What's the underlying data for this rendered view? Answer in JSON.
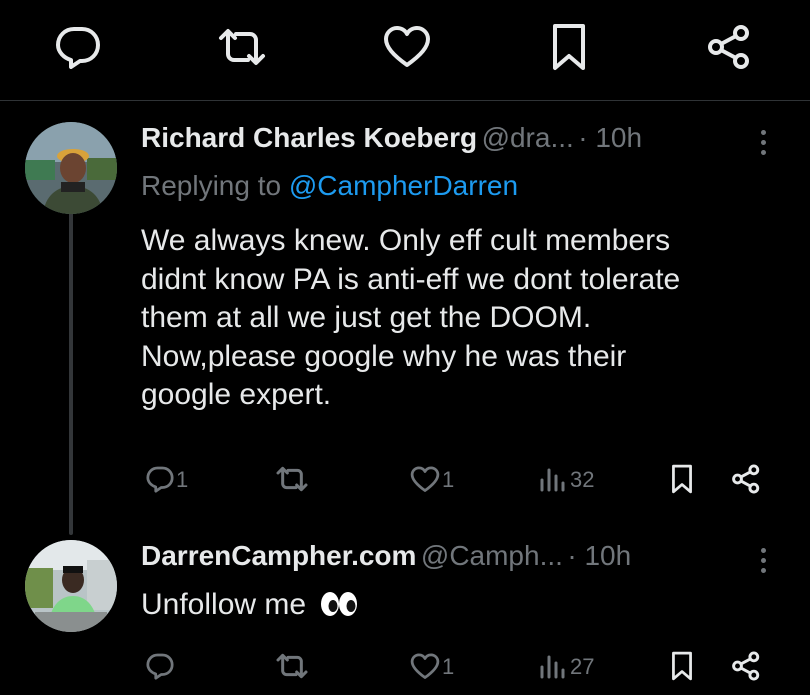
{
  "colors": {
    "background": "#000000",
    "text": "#e7e9ea",
    "muted": "#71767b",
    "accent": "#1d9bf0",
    "divider": "#2f3336"
  },
  "top_actions": [
    "reply-icon",
    "retweet-icon",
    "like-icon",
    "bookmark-icon",
    "share-icon"
  ],
  "tweets": [
    {
      "name": "Richard Charles Koeberg",
      "handle": "@dra...",
      "time": "· 10h",
      "reply_prefix": "Replying to ",
      "reply_to": "@CampherDarren",
      "lines": [
        "We always knew. Only eff cult members",
        "didnt know PA is anti-eff we dont tolerate",
        "them at all we just get the  DOOM.",
        "Now,please google why he was their",
        "google expert."
      ],
      "replies": "1",
      "likes": "1",
      "views": "32"
    },
    {
      "name": "DarrenCampher.com",
      "handle": "@Camph...",
      "time": "· 10h",
      "text": "Unfollow me",
      "emoji": "eyes-icon",
      "likes": "1",
      "views": "27"
    }
  ]
}
